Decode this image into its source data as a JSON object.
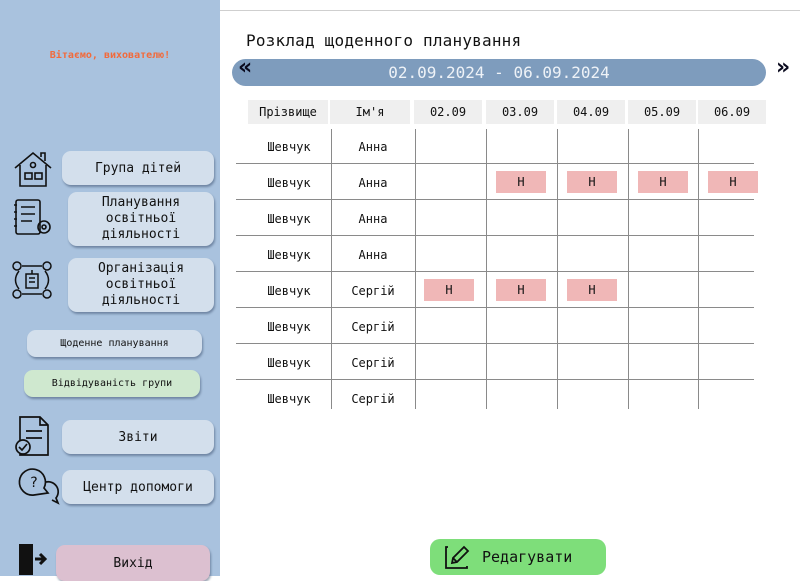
{
  "sidebar": {
    "greeting": "Вітаємо, вихователю!",
    "buttons": {
      "group": "Група дітей",
      "planning": "Планування освітньої діяльності",
      "organization": "Організація освітньої діяльності",
      "daily": "Щоденне планування",
      "attendance": "Відвідуваність групи",
      "reports": "Звіти",
      "help": "Центр допомоги",
      "exit": "Вихід"
    },
    "icons": [
      "house-icon",
      "checklist-icon",
      "network-icon",
      "report-icon",
      "help-icon",
      "exit-icon"
    ]
  },
  "main": {
    "title": "Розклад щоденного планування",
    "week_range": "02.09.2024 - 06.09.2024",
    "prev_arrow": "«",
    "next_arrow": "»",
    "edit_label": "Редагувати"
  },
  "table": {
    "headers": [
      "Прізвище",
      "Ім'я",
      "02.09",
      "03.09",
      "04.09",
      "05.09",
      "06.09"
    ],
    "rows": [
      {
        "surname": "Шевчук",
        "name": "Анна",
        "marks": [
          "",
          "",
          "",
          "",
          ""
        ]
      },
      {
        "surname": "Шевчук",
        "name": "Анна",
        "marks": [
          "",
          "Н",
          "Н",
          "Н",
          "Н"
        ]
      },
      {
        "surname": "Шевчук",
        "name": "Анна",
        "marks": [
          "",
          "",
          "",
          "",
          ""
        ]
      },
      {
        "surname": "Шевчук",
        "name": "Анна",
        "marks": [
          "",
          "",
          "",
          "",
          ""
        ]
      },
      {
        "surname": "Шевчук",
        "name": "Сергій",
        "marks": [
          "Н",
          "Н",
          "Н",
          "",
          ""
        ]
      },
      {
        "surname": "Шевчук",
        "name": "Сергій",
        "marks": [
          "",
          "",
          "",
          "",
          ""
        ]
      },
      {
        "surname": "Шевчук",
        "name": "Сергій",
        "marks": [
          "",
          "",
          "",
          "",
          ""
        ]
      },
      {
        "surname": "Шевчук",
        "name": "Сергій",
        "marks": [
          "",
          "",
          "",
          "",
          ""
        ]
      }
    ]
  },
  "colors": {
    "sidebar": "#a9c2de",
    "button": "#d3dfec",
    "attendance_button": "#cfe8cf",
    "exit_button": "#dcc0d0",
    "greeting": "#f26a3b",
    "week_bar": "#7e9cbd",
    "absence_mark": "#f0b7b7",
    "edit_button": "#7ede7a"
  }
}
